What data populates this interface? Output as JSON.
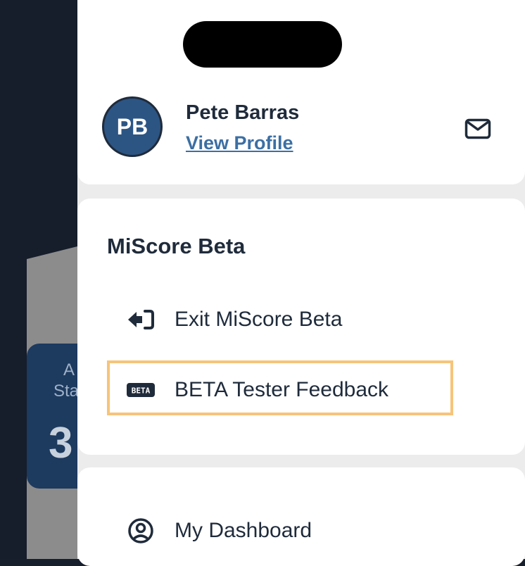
{
  "background": {
    "card_line1": "A",
    "card_line2": "Sta",
    "card_value": "3"
  },
  "profile": {
    "initials": "PB",
    "name": "Pete Barras",
    "view_profile_label": "View Profile",
    "mail_icon": "mail-icon"
  },
  "beta_section": {
    "title": "MiScore Beta",
    "items": [
      {
        "label": "Exit MiScore Beta",
        "icon": "exit-icon"
      },
      {
        "label": "BETA Tester Feedback",
        "icon": "beta-badge-icon"
      }
    ],
    "highlight_color": "#f6c47a"
  },
  "nav_section": {
    "items": [
      {
        "label": "My Dashboard",
        "icon": "user-circle-icon"
      }
    ]
  },
  "colors": {
    "navy_text": "#1f2b3b",
    "link": "#3c6fa3",
    "avatar_bg": "#2c5584"
  }
}
